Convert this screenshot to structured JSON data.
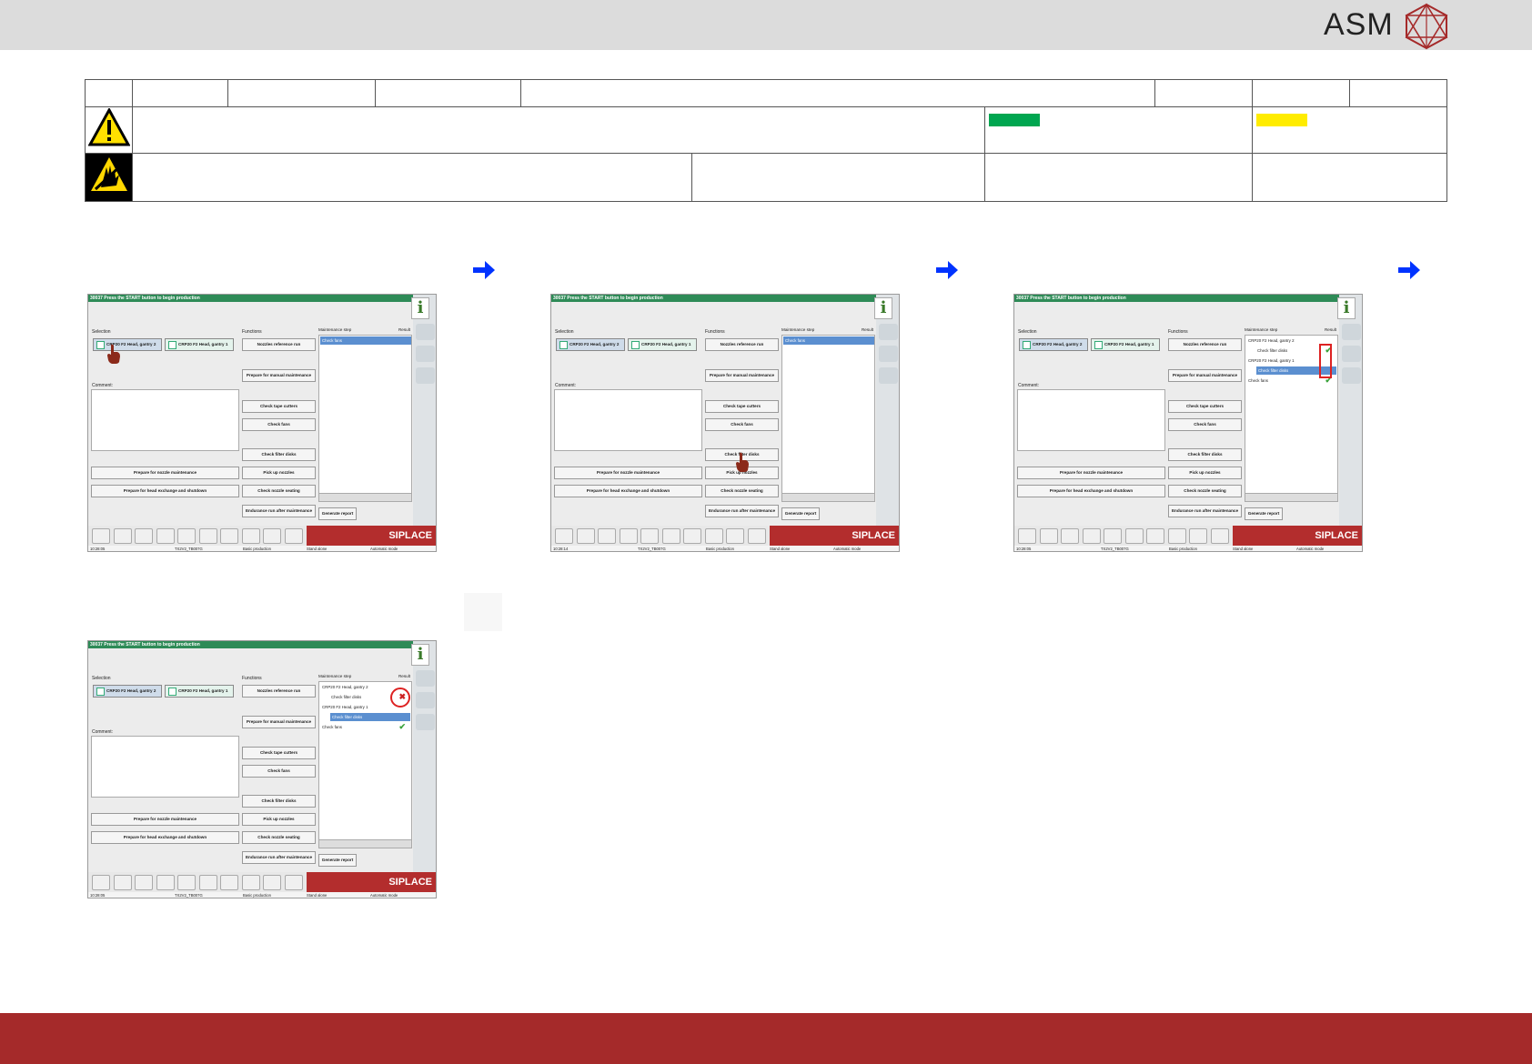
{
  "brand": {
    "name": "ASM",
    "colors": {
      "accent": "#a52a2a",
      "status_green": "#00a650",
      "status_yellow": "#ffec00"
    }
  },
  "header_table": {
    "warning_icon": "warning-triangle-icon",
    "esd_icon": "esd-hand-icon"
  },
  "screenshot": {
    "status_bar": "30037 Press the START button to begin production",
    "selection_label": "Selection",
    "functions_label": "Functions",
    "maintenance_step_label": "Maintenance step",
    "result_label": "Result",
    "comment_label": "Comment:",
    "chip_gantry2": "CRP20 F2 Head, gantry 2",
    "chip_gantry1": "CRP20 F2 Head, gantry 1",
    "btn_nozzles_ref": "Nozzles reference run",
    "btn_prepare_manual": "Prepare for manual maintenance",
    "btn_tape_cutters": "Check tape cutters",
    "btn_fans": "Check fans",
    "btn_filter_disks": "Check filter disks",
    "btn_nozzle_maint": "Prepare for nozzle maintenance",
    "btn_pick_up": "Pick up nozzles",
    "btn_head_exchange": "Prepare for head exchange and shutdown",
    "btn_nozzle_seating": "Check nozzle seating",
    "btn_endurance": "Endurance run after maintenance",
    "btn_generate_report": "Generate report",
    "siplace": "SIPLACE",
    "status_time": "10:28:05",
    "status_time2": "10:28:14",
    "status_station": "TX2V2_TB007G",
    "status_production": "Basic production",
    "status_stand": "Stand alone",
    "status_mode": "Automatic mode",
    "step_head_g2": "CRP20 F2 Head, gantry 2",
    "step_head_g1": "CRP20 F2 Head, gantry 1",
    "step_filter": "Check filter disks",
    "step_fans": "Check fans",
    "info_icon": "i"
  }
}
